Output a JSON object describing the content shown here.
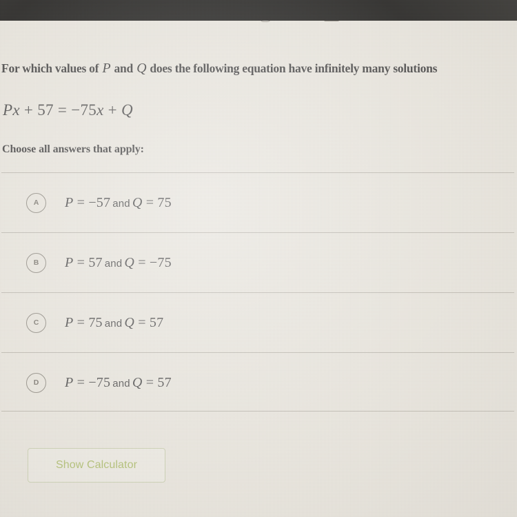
{
  "screen": {
    "background_color": "#ece9e2",
    "top_bar_color": "#010101"
  },
  "top_icons": [
    {
      "name": "partial-icon-left",
      "label": ""
    },
    {
      "name": "partial-icon-right",
      "label": ""
    }
  ],
  "question": {
    "stem_part_1": "For which values of ",
    "stem_var_p": "P",
    "stem_part_2": " and ",
    "stem_var_q": "Q",
    "stem_part_3": " does the following equation have infinitely many solutions",
    "equation": {
      "var_p": "P",
      "var_x1": "x",
      "plus_1": " + ",
      "const_57": "57",
      "equals": " = ",
      "minus_75x": "−75",
      "var_x2": "x",
      "plus_2": " + ",
      "var_q": "Q"
    },
    "instruction": "Choose all answers that apply:"
  },
  "choices": [
    {
      "letter": "A",
      "var_p": "P",
      "eq1": " = ",
      "p_value": "−57",
      "and": "and",
      "var_q": "Q",
      "eq2": " = ",
      "q_value": "75",
      "selected": false
    },
    {
      "letter": "B",
      "var_p": "P",
      "eq1": " = ",
      "p_value": "57",
      "and": "and",
      "var_q": "Q",
      "eq2": " = ",
      "q_value": "−75",
      "selected": false
    },
    {
      "letter": "C",
      "var_p": "P",
      "eq1": " = ",
      "p_value": "75",
      "and": "and",
      "var_q": "Q",
      "eq2": " = ",
      "q_value": "57",
      "selected": false
    },
    {
      "letter": "D",
      "var_p": "P",
      "eq1": " = ",
      "p_value": "−75",
      "and": "and",
      "var_q": "Q",
      "eq2": " = ",
      "q_value": "57",
      "selected": false
    }
  ],
  "calculator": {
    "label": "Show Calculator",
    "text_color": "#a9bb62",
    "border_color": "#c8cfae"
  }
}
